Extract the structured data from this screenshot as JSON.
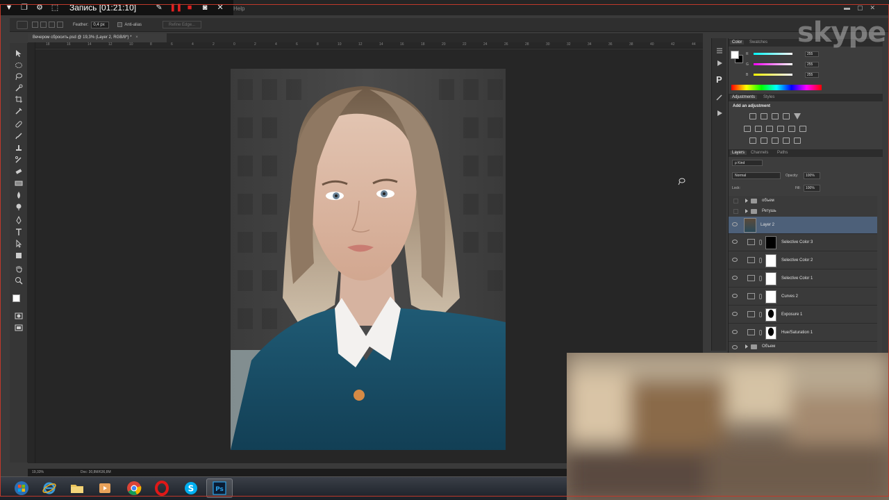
{
  "recorder": {
    "title": "Запись [01:21:10]",
    "icons": [
      "menu-arrow-icon",
      "restore-icon",
      "settings-icon",
      "fullscreen-icon",
      "pen-icon",
      "pause-icon",
      "stop-icon",
      "camera-icon",
      "close-icon"
    ]
  },
  "menubar": {
    "help": "Help"
  },
  "window_controls": [
    "minimize-icon",
    "maximize-icon",
    "close-icon"
  ],
  "options_bar": {
    "tool": "lasso-icon",
    "feather_label": "Feather:",
    "feather_value": "0,4 px",
    "anti_alias_label": "Anti-alias",
    "refine_edge_label": "Refine Edge..."
  },
  "document_tab": {
    "label": "Вечером сбросить.psd @ 19,3% (Layer 2, RGB/8*) *",
    "close": "×"
  },
  "ruler": {
    "labels": [
      "18",
      "16",
      "14",
      "12",
      "10",
      "8",
      "6",
      "4",
      "2",
      "0",
      "2",
      "4",
      "6",
      "8",
      "10",
      "12",
      "14",
      "16",
      "18",
      "20",
      "22",
      "24",
      "26",
      "28",
      "30",
      "32",
      "34",
      "36",
      "38",
      "40",
      "42",
      "44"
    ]
  },
  "status_bar": {
    "zoom": "19,33%",
    "doc": "Doc: 30,8M/636,8M"
  },
  "color_panel": {
    "tabs": [
      "Color",
      "Swatches"
    ],
    "channels": [
      {
        "label": "R",
        "value": "255"
      },
      {
        "label": "G",
        "value": "255"
      },
      {
        "label": "B",
        "value": "255"
      }
    ]
  },
  "adjustments_panel": {
    "tabs": [
      "Adjustments",
      "Styles"
    ],
    "heading": "Add an adjustment"
  },
  "layers_panel": {
    "tabs": [
      "Layers",
      "Channels",
      "Paths"
    ],
    "filter_label": "ρ Kind",
    "blend_mode": "Normal",
    "opacity_label": "Opacity:",
    "opacity_value": "100%",
    "lock_label": "Lock:",
    "fill_label": "Fill:",
    "fill_value": "100%",
    "groups_top": [
      "объем",
      "Ретушь"
    ],
    "layers": [
      {
        "name": "Layer 2",
        "selected": true
      },
      {
        "name": "Selective Color 3",
        "mask": "black"
      },
      {
        "name": "Selective Color 2",
        "mask": "white"
      },
      {
        "name": "Selective Color 1",
        "mask": "white"
      },
      {
        "name": "Curves 2",
        "mask": "white"
      },
      {
        "name": "Exposure 1",
        "mask": "silhouette"
      },
      {
        "name": "Hue/Saturation 1",
        "mask": "silhouette"
      }
    ],
    "group_bottom": "Объем"
  },
  "overlay": {
    "skype": "skype"
  },
  "taskbar": {
    "apps": [
      "windows-start-icon",
      "internet-explorer-icon",
      "file-explorer-icon",
      "media-player-icon",
      "chrome-icon",
      "opera-icon",
      "skype-icon",
      "photoshop-icon"
    ],
    "active": "photoshop-icon"
  },
  "colors": {
    "ui_bg": "#3a3a3a",
    "canvas_bg": "#262626",
    "selected_layer": "#4d6079",
    "frame_red": "#c0392b"
  }
}
